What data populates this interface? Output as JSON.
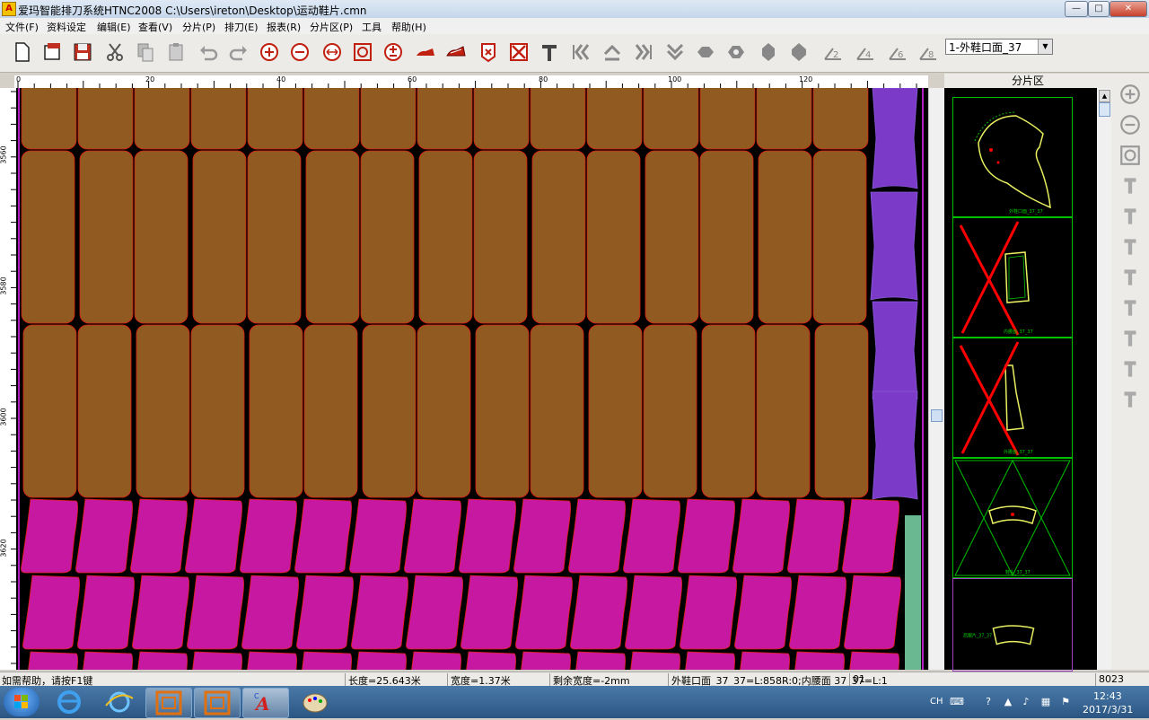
{
  "window": {
    "title": "爱玛智能排刀系统HTNC2008 C:\\Users\\ireton\\Desktop\\运动鞋片.cmn",
    "logo": "A",
    "minimize": "—",
    "maximize": "□",
    "close": "✕"
  },
  "menu": [
    "文件(F)",
    "资料设定",
    "编辑(E)",
    "查看(V)",
    "分片(P)",
    "排刀(E)",
    "报表(R)",
    "分片区(P)",
    "工具",
    "帮助(H)"
  ],
  "toolbar": {
    "piece_select": "1-外鞋口面_37",
    "buttons": [
      "new-file-icon",
      "open-file-icon",
      "save-icon",
      "cut-icon",
      "copy-icon",
      "paste-icon",
      "undo-icon",
      "redo-icon",
      "zoom-in-icon",
      "zoom-out-icon",
      "fit-width-icon",
      "zoom-fit-icon",
      "zoom-toggle-icon",
      "shoe-side-icon",
      "shoe-outline-icon",
      "mark-piece-icon",
      "delete-piece-icon",
      "text-icon",
      "align-left-icon",
      "move-up-icon",
      "align-right-icon",
      "move-down-icon",
      "flip-horizontal-icon",
      "rotate-icon",
      "flip-vertical-icon",
      "shape-icon",
      "angle-2-icon",
      "angle-4-icon",
      "angle-6-icon",
      "angle-8-icon"
    ]
  },
  "ruler": {
    "h_labels": [
      "0",
      "20",
      "40",
      "60",
      "80",
      "100",
      "120"
    ],
    "v_labels": [
      "3560",
      "3580",
      "3600",
      "3620"
    ]
  },
  "panel": {
    "title": "分片区",
    "pieces": [
      {
        "label": "外鞋口面_37_37",
        "crossed": false
      },
      {
        "label": "内腰面_37_37",
        "crossed": true
      },
      {
        "label": "外腰面_37_37",
        "crossed": true
      },
      {
        "label": "鞋头_37_37",
        "crossed": false
      },
      {
        "label": "后跟片_37_37",
        "crossed": false
      }
    ]
  },
  "colors": {
    "brown_piece": "#915a20",
    "magenta_piece": "#c618a0",
    "purple_piece": "#7b3bc8",
    "teal_strip": "#6ab892",
    "piece_outline": "#e02010"
  },
  "status": {
    "help": "如需帮助，请按F1键",
    "length": "长度=25.643米",
    "width": "宽度=1.37米",
    "remain": "剩余宽度=-2mm",
    "piece_info": "外鞋口面_37_37=L:858R:0;内腰面 37_37=L:1",
    "code": "01",
    "count": "8023"
  },
  "taskbar": {
    "lang": "CH",
    "time": "12:43",
    "date": "2017/3/31"
  }
}
